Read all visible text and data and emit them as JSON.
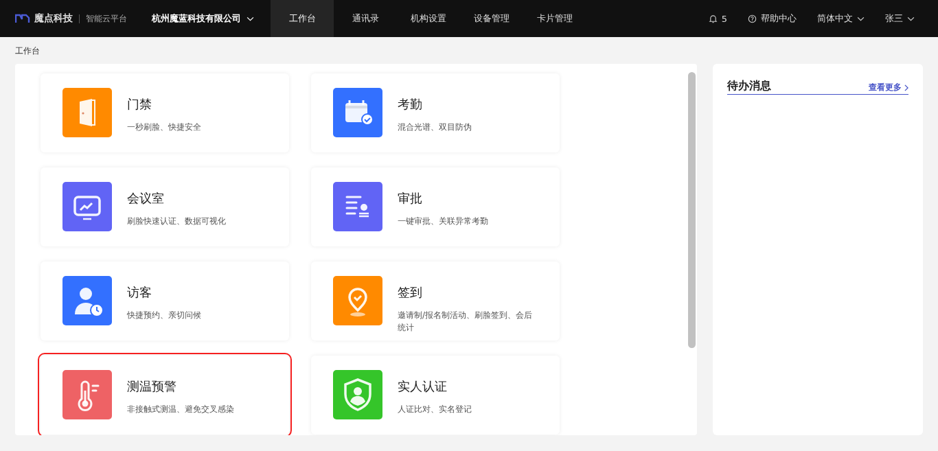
{
  "header": {
    "brand": "魔点科技",
    "platform": "智能云平台",
    "company": "杭州魔蓝科技有限公司",
    "nav": [
      {
        "label": "工作台",
        "selected": true
      },
      {
        "label": "通讯录",
        "selected": false
      },
      {
        "label": "机构设置",
        "selected": false
      },
      {
        "label": "设备管理",
        "selected": false
      },
      {
        "label": "卡片管理",
        "selected": false
      }
    ],
    "notifications": "5",
    "help": "帮助中心",
    "language": "简体中文",
    "user": "张三"
  },
  "breadcrumb": "工作台",
  "apps": [
    {
      "kind": "door",
      "color": "#ff8a00",
      "title": "门禁",
      "description": "一秒刷脸、快捷安全",
      "highlighted": false
    },
    {
      "kind": "calendar",
      "color": "#3370ff",
      "title": "考勤",
      "description": "混合光谱、双目防伪",
      "highlighted": false
    },
    {
      "kind": "monitor",
      "color": "#6164f5",
      "title": "会议室",
      "description": "刷脸快速认证、数据可视化",
      "highlighted": false
    },
    {
      "kind": "document",
      "color": "#6164f5",
      "title": "审批",
      "description": "一键审批、关联异常考勤",
      "highlighted": false
    },
    {
      "kind": "visitor",
      "color": "#3370ff",
      "title": "访客",
      "description": "快捷预约、亲切问候",
      "highlighted": false
    },
    {
      "kind": "location",
      "color": "#ff8a00",
      "title": "签到",
      "description": "邀请制/报名制活动、刷脸签到、会后统计",
      "highlighted": false
    },
    {
      "kind": "thermometer",
      "color": "#ee6265",
      "title": "测温预警",
      "description": "非接触式测温、避免交叉感染",
      "highlighted": true
    },
    {
      "kind": "shield",
      "color": "#35c52a",
      "title": "实人认证",
      "description": "人证比对、实名登记",
      "highlighted": false
    }
  ],
  "todo": {
    "title": "待办消息",
    "more": "查看更多"
  }
}
